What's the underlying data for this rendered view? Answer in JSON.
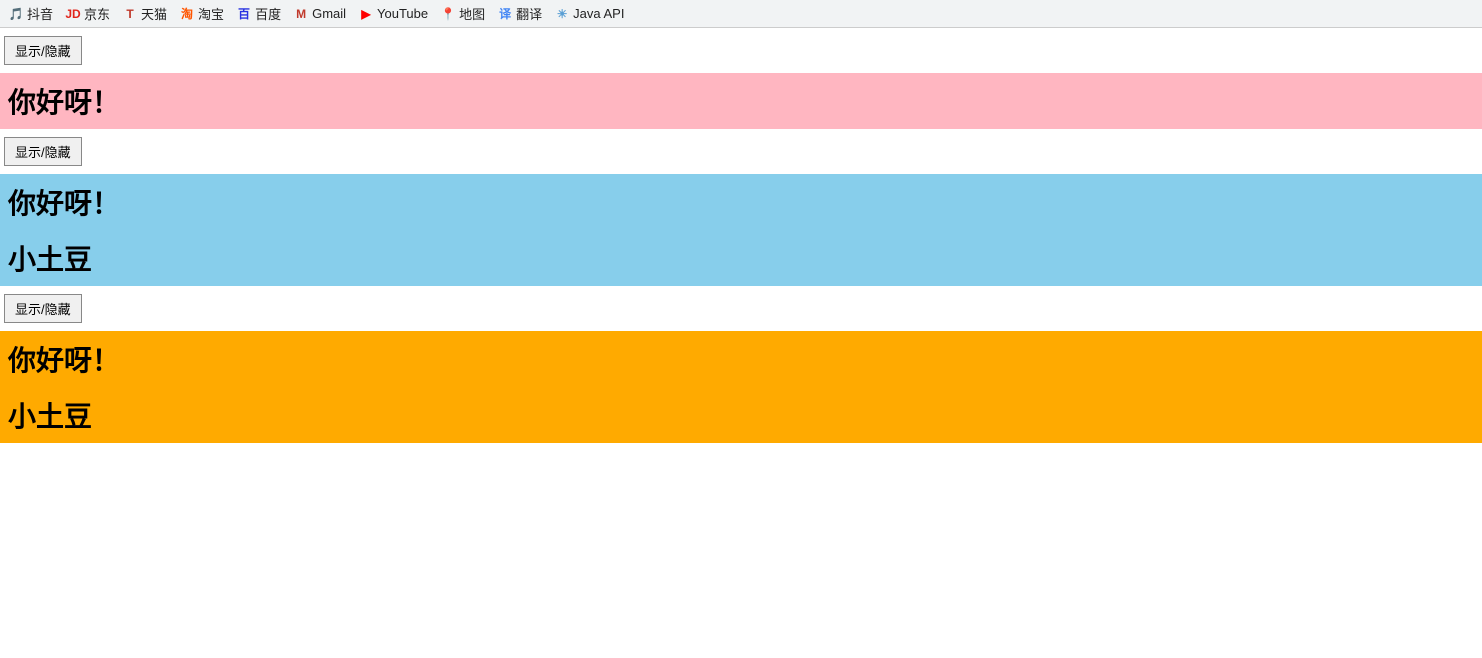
{
  "bookmarks": [
    {
      "id": "douyin",
      "label": "抖音",
      "icon": "🎵",
      "color": "#000"
    },
    {
      "id": "jd",
      "label": "京东",
      "icon": "JD",
      "color": "#e1251b"
    },
    {
      "id": "tianmao",
      "label": "天猫",
      "icon": "T",
      "color": "#c0392b"
    },
    {
      "id": "taobao",
      "label": "淘宝",
      "icon": "淘",
      "color": "#ff5500"
    },
    {
      "id": "baidu",
      "label": "百度",
      "icon": "百",
      "color": "#2932e1"
    },
    {
      "id": "gmail",
      "label": "Gmail",
      "icon": "M",
      "color": "#c0392b"
    },
    {
      "id": "youtube",
      "label": "YouTube",
      "icon": "▶",
      "color": "#ff0000"
    },
    {
      "id": "maps",
      "label": "地图",
      "icon": "📍",
      "color": "#4285f4"
    },
    {
      "id": "translate",
      "label": "翻译",
      "icon": "译",
      "color": "#4285f4"
    },
    {
      "id": "javaapi",
      "label": "Java API",
      "icon": "☀",
      "color": "#5a9fd4"
    }
  ],
  "buttons": {
    "toggle_label": "显示/隐藏"
  },
  "sections": [
    {
      "id": "section1",
      "button": true,
      "blocks": [
        {
          "text": "你好呀！",
          "color_class": "pink-block"
        }
      ]
    },
    {
      "id": "section2",
      "button": true,
      "blocks": [
        {
          "text": "你好呀！",
          "color_class": "blue-block"
        },
        {
          "text": "小土豆",
          "color_class": "blue-block"
        }
      ]
    },
    {
      "id": "section3",
      "button": true,
      "blocks": [
        {
          "text": "你好呀！",
          "color_class": "orange-block"
        },
        {
          "text": "小土豆",
          "color_class": "orange-block"
        }
      ]
    }
  ]
}
